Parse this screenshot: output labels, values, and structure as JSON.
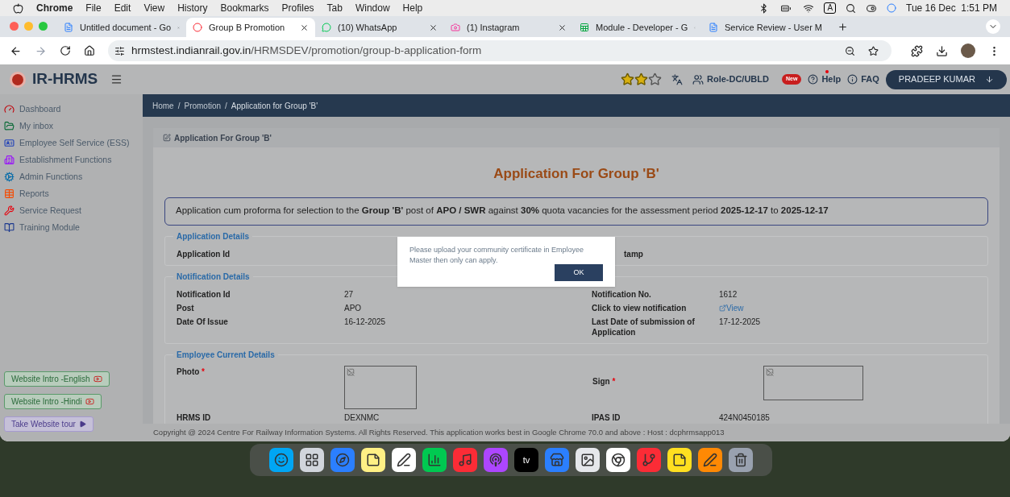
{
  "menu_bar": {
    "app": "Chrome",
    "items": [
      "File",
      "Edit",
      "View",
      "History",
      "Bookmarks",
      "Profiles",
      "Tab",
      "Window",
      "Help"
    ],
    "input_source": "A",
    "clock": "Tue 16 Dec  1:51 PM"
  },
  "tabs": [
    {
      "title": "Untitled document - Go",
      "kind": "doc",
      "selected": false
    },
    {
      "title": "Group B Promotion",
      "kind": "site",
      "selected": true
    },
    {
      "title": "(10) WhatsApp",
      "kind": "chat",
      "selected": false
    },
    {
      "title": "(1) Instagram",
      "kind": "camera",
      "selected": false
    },
    {
      "title": "Module - Developer - G",
      "kind": "sheet",
      "selected": false
    },
    {
      "title": "Service Review - User M",
      "kind": "doc",
      "selected": false
    }
  ],
  "address_bar": {
    "host": "hrmstest.indianrail.gov.in",
    "path": "/HRMSDEV/promotion/group-b-application-form"
  },
  "app_header": {
    "brand": "IR-HRMS",
    "stars": 2,
    "role": "Role-DC/UBLD",
    "new_badge": "New",
    "help": "Help",
    "faq": "FAQ",
    "user": "PRADEEP KUMAR"
  },
  "sidebar": {
    "items": [
      {
        "label": "Dashboard",
        "kind": "dashboard"
      },
      {
        "label": "My inbox",
        "kind": "inbox"
      },
      {
        "label": "Employee Self Service (ESS)",
        "kind": "ess"
      },
      {
        "label": "Establishment Functions",
        "kind": "establishment"
      },
      {
        "label": "Admin Functions",
        "kind": "admin"
      },
      {
        "label": "Reports",
        "kind": "reports"
      },
      {
        "label": "Service Request",
        "kind": "service"
      },
      {
        "label": "Training Module",
        "kind": "training"
      }
    ],
    "buttons": [
      {
        "label": "Website Intro -English",
        "kind": "video"
      },
      {
        "label": "Website Intro -Hindi",
        "kind": "video"
      },
      {
        "label": "Take Website tour",
        "kind": "tour"
      }
    ]
  },
  "breadcrumb": [
    {
      "label": "Home"
    },
    {
      "separator": "/",
      "label": "Promotion"
    },
    {
      "separator": "/",
      "label": "Application for Group 'B'"
    }
  ],
  "card": {
    "header": "Application For Group 'B'",
    "title": "Application For Group 'B'",
    "notice": "Application cum proforma for selection to the **Group 'B'** post of **APO / SWR** against **30%** quota vacancies for the assessment period **2025-12-17** to **2025-12-17**",
    "sections": [
      {
        "title": "Application Details",
        "rows": [
          {
            "label": "Application Id",
            "value": "",
            "label2": "tamp",
            "value2": ""
          }
        ]
      },
      {
        "title": "Notification Details",
        "rows": [
          {
            "label": "Notification Id",
            "value": "27",
            "label2": "Notification No.",
            "value2": "1612"
          },
          {
            "label": "Post",
            "value": "APO",
            "label2": "Click to view notification",
            "value2": "View",
            "link": true
          },
          {
            "label": "Date Of Issue",
            "value": "16-12-2025",
            "label2": "Last Date of submission of Application",
            "value2": "17-12-2025"
          }
        ]
      },
      {
        "title": "Employee Current Details",
        "photo_label": "Photo",
        "photo_required": "*",
        "sign_label": "Sign",
        "sign_required": "*",
        "rows": [
          {
            "label": "HRMS ID",
            "value": "DEXNMC",
            "label2": "IPAS ID",
            "value2": "424N0450185"
          }
        ]
      }
    ]
  },
  "footer": "Copyright @ 2024 Centre For Railway Information Systems. All Rights Reserved. This application works best in Google Chrome 70.0 and above : Host : dcphrmsapp013",
  "dialog": {
    "message": "Please upload your community certificate in Employee Master then only can apply.",
    "button": "OK"
  },
  "dock": [
    {
      "kind": "finder"
    },
    {
      "kind": "grid"
    },
    {
      "kind": "compass"
    },
    {
      "kind": "notes"
    },
    {
      "kind": "board"
    },
    {
      "kind": "chart"
    },
    {
      "kind": "music"
    },
    {
      "kind": "podcast"
    },
    {
      "kind": "tv",
      "label": "tv"
    },
    {
      "kind": "store"
    },
    {
      "kind": "preview"
    },
    {
      "kind": "browser"
    },
    {
      "kind": "git"
    },
    {
      "kind": "sticky"
    },
    {
      "kind": "pen"
    },
    {
      "kind": "trash"
    }
  ]
}
